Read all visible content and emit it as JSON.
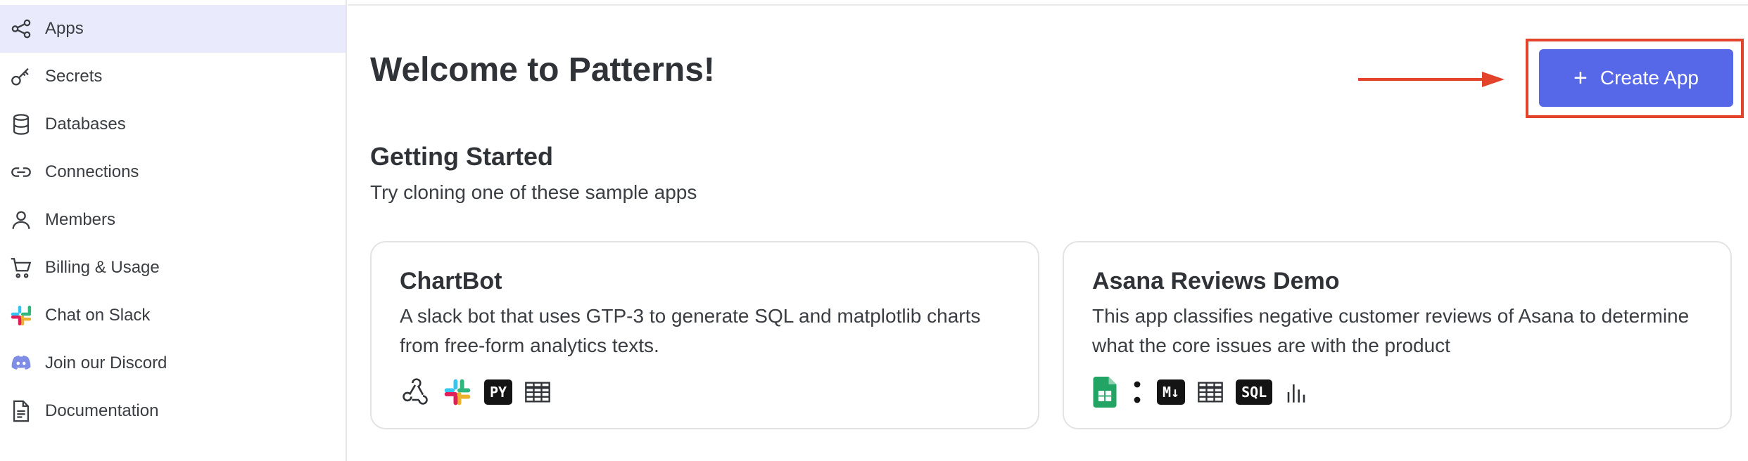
{
  "sidebar": {
    "items": [
      {
        "label": "Apps",
        "icon": "share-nodes-icon",
        "active": true
      },
      {
        "label": "Secrets",
        "icon": "key-icon",
        "active": false
      },
      {
        "label": "Databases",
        "icon": "database-icon",
        "active": false
      },
      {
        "label": "Connections",
        "icon": "link-icon",
        "active": false
      },
      {
        "label": "Members",
        "icon": "user-icon",
        "active": false
      },
      {
        "label": "Billing & Usage",
        "icon": "cart-icon",
        "active": false
      },
      {
        "label": "Chat on Slack",
        "icon": "slack-icon",
        "active": false
      },
      {
        "label": "Join our Discord",
        "icon": "discord-icon",
        "active": false
      },
      {
        "label": "Documentation",
        "icon": "document-icon",
        "active": false
      }
    ]
  },
  "main": {
    "title": "Welcome to Patterns!",
    "create_button": {
      "label": "Create App",
      "icon": "plus-icon"
    },
    "getting_started": {
      "title": "Getting Started",
      "subtitle": "Try cloning one of these sample apps"
    },
    "cards": [
      {
        "title": "ChartBot",
        "description": "A slack bot that uses GTP-3 to generate SQL and matplotlib charts from free-form analytics texts.",
        "icons": [
          "webhook-icon",
          "slack-icon",
          "python-badge",
          "table-icon"
        ],
        "badge_python": "PY"
      },
      {
        "title": "Asana Reviews Demo",
        "description": "This app classifies negative customer reviews of Asana to determine what the core issues are with the product",
        "icons": [
          "google-sheets-icon",
          "openai-icon",
          "markdown-badge",
          "table-icon",
          "sql-badge",
          "bar-chart-icon"
        ],
        "badge_markdown": "M↓",
        "badge_sql": "SQL"
      }
    ]
  },
  "colors": {
    "accent": "#5668e8",
    "active_nav_bg": "#e9ebfc",
    "highlight": "#e4432b"
  }
}
